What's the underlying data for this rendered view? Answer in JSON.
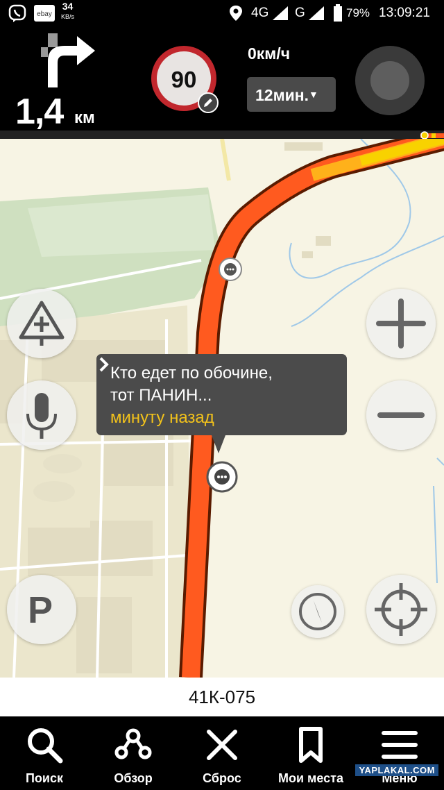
{
  "status_bar": {
    "net_speed_value": "34",
    "net_speed_unit": "KB/s",
    "network_4g": "4G",
    "network_g": "G",
    "battery": "79%",
    "time": "13:09:21",
    "icons": [
      "viber-icon",
      "ebay-icon",
      "location-icon",
      "signal-icon",
      "battery-icon"
    ]
  },
  "nav": {
    "maneuver_icon": "turn-right-icon",
    "distance_value": "1,4",
    "distance_unit": "км",
    "speed_limit": "90",
    "current_speed": "0км/ч",
    "eta": "12мин.",
    "colors": {
      "speed_limit_ring": "#c1272d",
      "route": "#ff5a1f"
    }
  },
  "map": {
    "bubble": {
      "line1": "Кто едет по обочине,",
      "line2": "тот ПАНИН...",
      "time": "минуту назад"
    },
    "buttons": [
      "add-road-event",
      "microphone",
      "parking",
      "zoom-in",
      "zoom-out",
      "compass",
      "locate-me"
    ],
    "parking_label": "P"
  },
  "street_name": "41К-075",
  "bottom_nav": {
    "search": "Поиск",
    "overview": "Обзор",
    "reset": "Сброс",
    "my_places": "Мои места",
    "menu": "Меню"
  },
  "watermark": "YAPLAKAL.COM"
}
